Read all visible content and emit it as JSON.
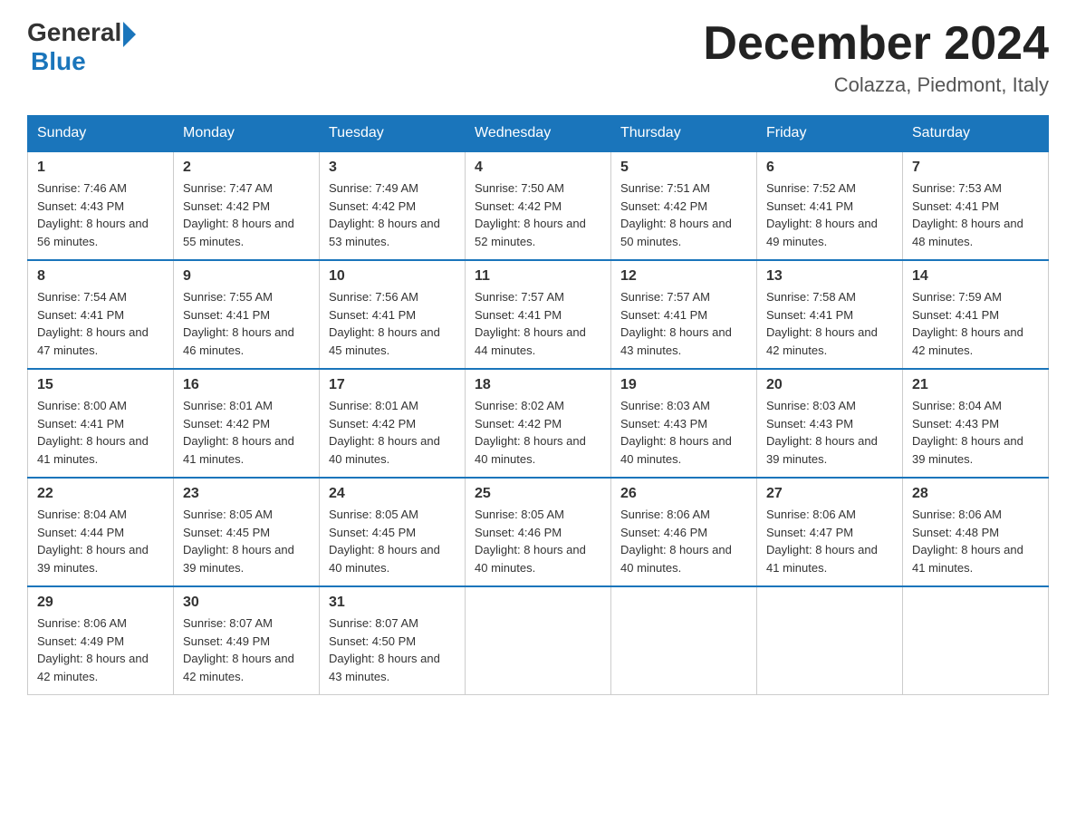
{
  "logo": {
    "general": "General",
    "blue": "Blue"
  },
  "title": "December 2024",
  "location": "Colazza, Piedmont, Italy",
  "days_of_week": [
    "Sunday",
    "Monday",
    "Tuesday",
    "Wednesday",
    "Thursday",
    "Friday",
    "Saturday"
  ],
  "weeks": [
    [
      {
        "day": "1",
        "sunrise": "7:46 AM",
        "sunset": "4:43 PM",
        "daylight": "8 hours and 56 minutes."
      },
      {
        "day": "2",
        "sunrise": "7:47 AM",
        "sunset": "4:42 PM",
        "daylight": "8 hours and 55 minutes."
      },
      {
        "day": "3",
        "sunrise": "7:49 AM",
        "sunset": "4:42 PM",
        "daylight": "8 hours and 53 minutes."
      },
      {
        "day": "4",
        "sunrise": "7:50 AM",
        "sunset": "4:42 PM",
        "daylight": "8 hours and 52 minutes."
      },
      {
        "day": "5",
        "sunrise": "7:51 AM",
        "sunset": "4:42 PM",
        "daylight": "8 hours and 50 minutes."
      },
      {
        "day": "6",
        "sunrise": "7:52 AM",
        "sunset": "4:41 PM",
        "daylight": "8 hours and 49 minutes."
      },
      {
        "day": "7",
        "sunrise": "7:53 AM",
        "sunset": "4:41 PM",
        "daylight": "8 hours and 48 minutes."
      }
    ],
    [
      {
        "day": "8",
        "sunrise": "7:54 AM",
        "sunset": "4:41 PM",
        "daylight": "8 hours and 47 minutes."
      },
      {
        "day": "9",
        "sunrise": "7:55 AM",
        "sunset": "4:41 PM",
        "daylight": "8 hours and 46 minutes."
      },
      {
        "day": "10",
        "sunrise": "7:56 AM",
        "sunset": "4:41 PM",
        "daylight": "8 hours and 45 minutes."
      },
      {
        "day": "11",
        "sunrise": "7:57 AM",
        "sunset": "4:41 PM",
        "daylight": "8 hours and 44 minutes."
      },
      {
        "day": "12",
        "sunrise": "7:57 AM",
        "sunset": "4:41 PM",
        "daylight": "8 hours and 43 minutes."
      },
      {
        "day": "13",
        "sunrise": "7:58 AM",
        "sunset": "4:41 PM",
        "daylight": "8 hours and 42 minutes."
      },
      {
        "day": "14",
        "sunrise": "7:59 AM",
        "sunset": "4:41 PM",
        "daylight": "8 hours and 42 minutes."
      }
    ],
    [
      {
        "day": "15",
        "sunrise": "8:00 AM",
        "sunset": "4:41 PM",
        "daylight": "8 hours and 41 minutes."
      },
      {
        "day": "16",
        "sunrise": "8:01 AM",
        "sunset": "4:42 PM",
        "daylight": "8 hours and 41 minutes."
      },
      {
        "day": "17",
        "sunrise": "8:01 AM",
        "sunset": "4:42 PM",
        "daylight": "8 hours and 40 minutes."
      },
      {
        "day": "18",
        "sunrise": "8:02 AM",
        "sunset": "4:42 PM",
        "daylight": "8 hours and 40 minutes."
      },
      {
        "day": "19",
        "sunrise": "8:03 AM",
        "sunset": "4:43 PM",
        "daylight": "8 hours and 40 minutes."
      },
      {
        "day": "20",
        "sunrise": "8:03 AM",
        "sunset": "4:43 PM",
        "daylight": "8 hours and 39 minutes."
      },
      {
        "day": "21",
        "sunrise": "8:04 AM",
        "sunset": "4:43 PM",
        "daylight": "8 hours and 39 minutes."
      }
    ],
    [
      {
        "day": "22",
        "sunrise": "8:04 AM",
        "sunset": "4:44 PM",
        "daylight": "8 hours and 39 minutes."
      },
      {
        "day": "23",
        "sunrise": "8:05 AM",
        "sunset": "4:45 PM",
        "daylight": "8 hours and 39 minutes."
      },
      {
        "day": "24",
        "sunrise": "8:05 AM",
        "sunset": "4:45 PM",
        "daylight": "8 hours and 40 minutes."
      },
      {
        "day": "25",
        "sunrise": "8:05 AM",
        "sunset": "4:46 PM",
        "daylight": "8 hours and 40 minutes."
      },
      {
        "day": "26",
        "sunrise": "8:06 AM",
        "sunset": "4:46 PM",
        "daylight": "8 hours and 40 minutes."
      },
      {
        "day": "27",
        "sunrise": "8:06 AM",
        "sunset": "4:47 PM",
        "daylight": "8 hours and 41 minutes."
      },
      {
        "day": "28",
        "sunrise": "8:06 AM",
        "sunset": "4:48 PM",
        "daylight": "8 hours and 41 minutes."
      }
    ],
    [
      {
        "day": "29",
        "sunrise": "8:06 AM",
        "sunset": "4:49 PM",
        "daylight": "8 hours and 42 minutes."
      },
      {
        "day": "30",
        "sunrise": "8:07 AM",
        "sunset": "4:49 PM",
        "daylight": "8 hours and 42 minutes."
      },
      {
        "day": "31",
        "sunrise": "8:07 AM",
        "sunset": "4:50 PM",
        "daylight": "8 hours and 43 minutes."
      },
      null,
      null,
      null,
      null
    ]
  ]
}
